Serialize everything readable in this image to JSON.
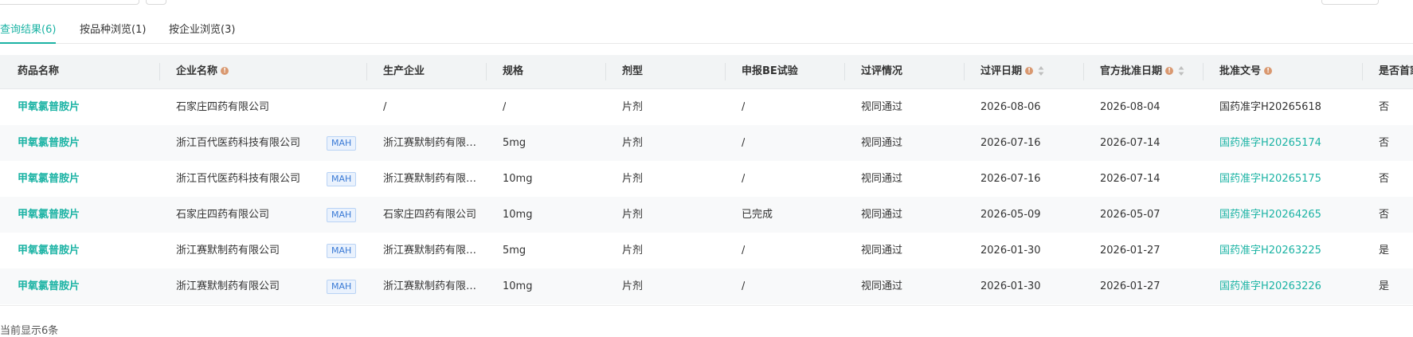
{
  "tabs": [
    {
      "label": "查询结果(6)",
      "active": true
    },
    {
      "label": "按品种浏览(1)",
      "active": false
    },
    {
      "label": "按企业浏览(3)",
      "active": false
    }
  ],
  "columns": {
    "drug": "药品名称",
    "company": "企业名称",
    "manufacturer": "生产企业",
    "spec": "规格",
    "form": "剂型",
    "be": "申报BE试验",
    "status": "过评情况",
    "eval_date": "过评日期",
    "approval_date": "官方批准日期",
    "approval_no": "批准文号",
    "first": "是否首家"
  },
  "rows": [
    {
      "drug": "甲氧氯普胺片",
      "company": "石家庄四药有限公司",
      "mah": "",
      "manufacturer": "/",
      "spec": "/",
      "form": "片剂",
      "be": "/",
      "status": "视同通过",
      "eval_date": "2026-08-06",
      "approval_date": "2026-08-04",
      "approval_no": "国药准字H20265618",
      "approval_no_link": false,
      "first": "否"
    },
    {
      "drug": "甲氧氯普胺片",
      "company": "浙江百代医药科技有限公司",
      "mah": "MAH",
      "manufacturer": "浙江赛默制药有限…",
      "spec": "5mg",
      "form": "片剂",
      "be": "/",
      "status": "视同通过",
      "eval_date": "2026-07-16",
      "approval_date": "2026-07-14",
      "approval_no": "国药准字H20265174",
      "approval_no_link": true,
      "first": "否"
    },
    {
      "drug": "甲氧氯普胺片",
      "company": "浙江百代医药科技有限公司",
      "mah": "MAH",
      "manufacturer": "浙江赛默制药有限…",
      "spec": "10mg",
      "form": "片剂",
      "be": "/",
      "status": "视同通过",
      "eval_date": "2026-07-16",
      "approval_date": "2026-07-14",
      "approval_no": "国药准字H20265175",
      "approval_no_link": true,
      "first": "否"
    },
    {
      "drug": "甲氧氯普胺片",
      "company": "石家庄四药有限公司",
      "mah": "MAH",
      "manufacturer": "石家庄四药有限公司",
      "spec": "10mg",
      "form": "片剂",
      "be": "已完成",
      "status": "视同通过",
      "eval_date": "2026-05-09",
      "approval_date": "2026-05-07",
      "approval_no": "国药准字H20264265",
      "approval_no_link": true,
      "first": "否"
    },
    {
      "drug": "甲氧氯普胺片",
      "company": "浙江赛默制药有限公司",
      "mah": "MAH",
      "manufacturer": "浙江赛默制药有限…",
      "spec": "5mg",
      "form": "片剂",
      "be": "/",
      "status": "视同通过",
      "eval_date": "2026-01-30",
      "approval_date": "2026-01-27",
      "approval_no": "国药准字H20263225",
      "approval_no_link": true,
      "first": "是"
    },
    {
      "drug": "甲氧氯普胺片",
      "company": "浙江赛默制药有限公司",
      "mah": "MAH",
      "manufacturer": "浙江赛默制药有限…",
      "spec": "10mg",
      "form": "片剂",
      "be": "/",
      "status": "视同通过",
      "eval_date": "2026-01-30",
      "approval_date": "2026-01-27",
      "approval_no": "国药准字H20263226",
      "approval_no_link": true,
      "first": "是"
    }
  ],
  "footer": {
    "count_text": "当前显示6条"
  },
  "colors": {
    "accent": "#1bb3a4",
    "mah_text": "#3b7bd6",
    "info_icon": "#d99870"
  }
}
